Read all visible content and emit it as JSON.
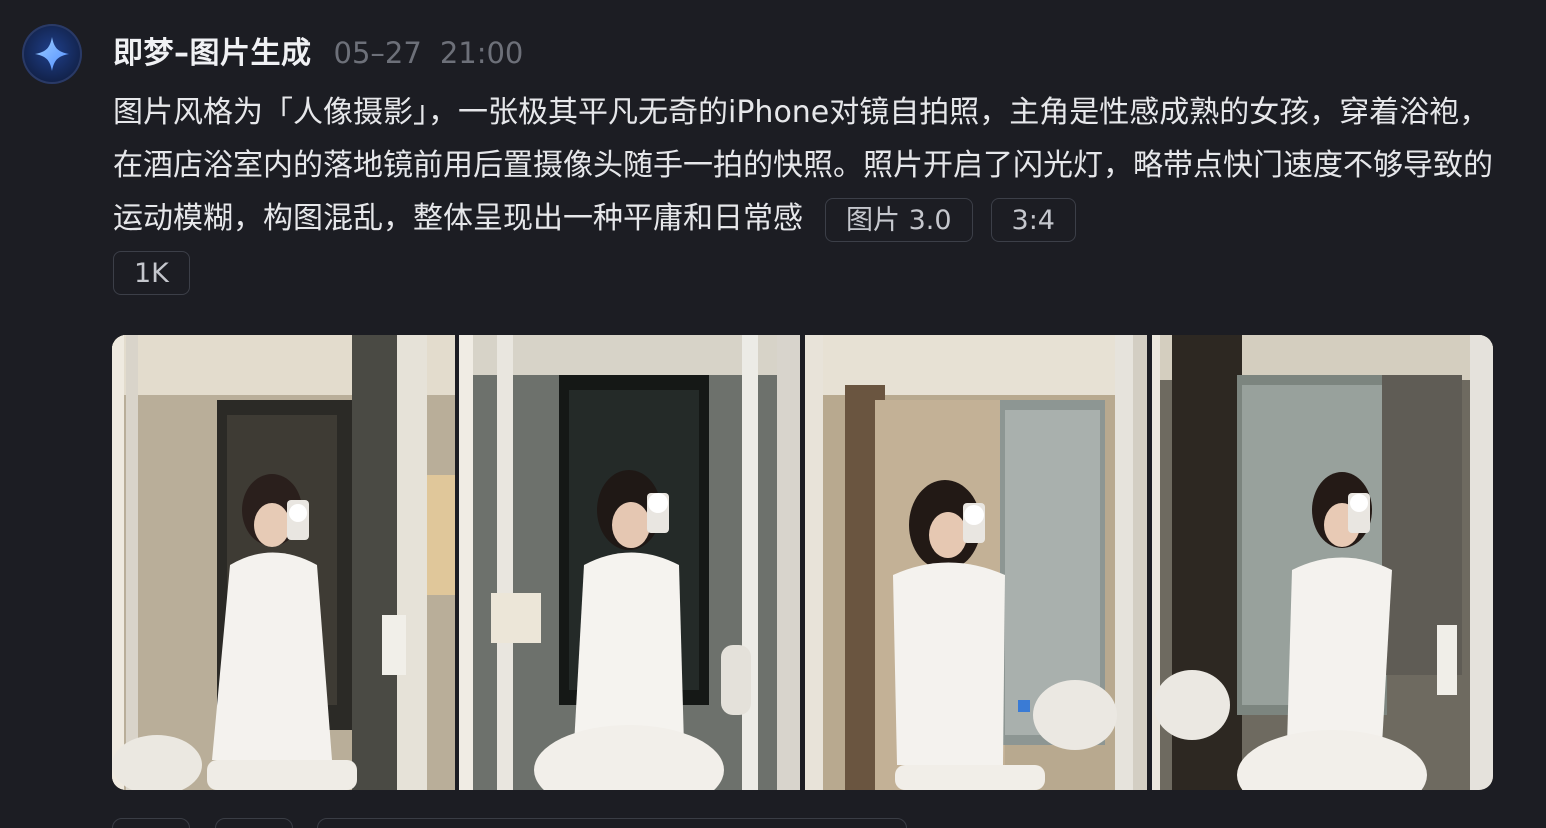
{
  "message": {
    "avatar_icon": "sparkle-star-icon",
    "app_name": "即梦–图片生成",
    "date": "05–27",
    "time": "21:00",
    "prompt_text": "图片风格为「人像摄影」，一张极其平凡无奇的iPhone对镜自拍照，主角是性感成熟的女孩，穿着浴袍，在酒店浴室内的落地镜前用后置摄像头随手一拍的快照。照片开启了闪光灯，略带点快门速度不够导致的运动模糊，构图混乱，整体呈现出一种平庸和日常感",
    "tags": [
      "图片 3.0",
      "3:4",
      "1K"
    ]
  },
  "gallery": {
    "images": [
      {
        "subject": "bathroom-mirror-selfie-image"
      },
      {
        "subject": "bathroom-mirror-selfie-image"
      },
      {
        "subject": "bathroom-mirror-selfie-image"
      },
      {
        "subject": "bathroom-mirror-selfie-image"
      }
    ]
  },
  "colors": {
    "background": "#1c1d23",
    "text_primary": "#e6e7ea",
    "text_muted": "#6d7079",
    "tag_border": "#3c3f48"
  }
}
